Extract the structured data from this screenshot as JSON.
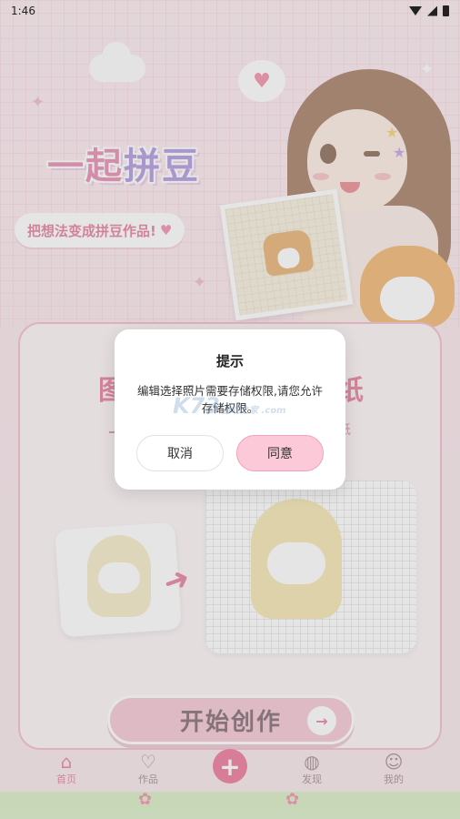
{
  "status_bar": {
    "time": "1:46"
  },
  "hero": {
    "logo_text_part1": "一起",
    "logo_text_part2": "拼豆",
    "slogan": "把想法变成拼豆作品!",
    "slogan_heart": "♥"
  },
  "card": {
    "title_left": "图",
    "title_right": "纸",
    "subtitle_right": "纸",
    "start_button": "开始创作",
    "start_arrow": "→"
  },
  "dialog": {
    "title": "提示",
    "message": "编辑选择照片需要存储权限,请您允许存储权限。",
    "cancel_label": "取消",
    "agree_label": "同意",
    "watermark": "K73",
    "watermark_sub": "游戏之家 .com"
  },
  "bottom_nav": {
    "items": [
      {
        "label": "首页",
        "icon": "home-icon"
      },
      {
        "label": "作品",
        "icon": "heart-icon"
      },
      {
        "label": "",
        "icon": "plus-icon"
      },
      {
        "label": "发现",
        "icon": "planet-icon"
      },
      {
        "label": "我的",
        "icon": "cat-face-icon"
      }
    ]
  },
  "colors": {
    "accent": "#e0587f",
    "agree_button_bg": "#fbc9d8",
    "plus_button_bg": "#ea4f7c"
  }
}
